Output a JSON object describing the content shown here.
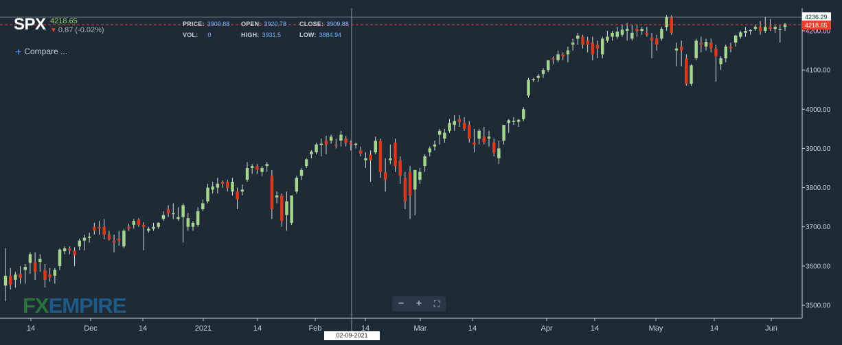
{
  "header": {
    "symbol": "SPX",
    "last_price": "4218.65",
    "change": "0.87 (-0.02%)",
    "price_label": "PRICE:",
    "price_value": "3909.88",
    "open_label": "OPEN:",
    "open_value": "3920.78",
    "close_label": "CLOSE:",
    "close_value": "3909.88",
    "vol_label": "VOL:",
    "vol_value": "0",
    "high_label": "HIGH:",
    "high_value": "3931.5",
    "low_label": "LOW:",
    "low_value": "3884.94"
  },
  "compare": {
    "label": "Compare ..."
  },
  "zoom": {
    "minus": "−",
    "plus": "+",
    "fullscreen": "⛶"
  },
  "logo": {
    "fx": "FX",
    "empire": "EMPIRE"
  },
  "crosshair": {
    "date": "02-09-2021"
  },
  "colors": {
    "up": "#a6d68e",
    "down": "#d63a1f",
    "wick": "#d7dde3",
    "background": "#1e2a35",
    "crosshair": "#8a96a3",
    "price_line": "#e4402c"
  },
  "chart_data": {
    "type": "candlestick",
    "ylim": [
      3475,
      4250
    ],
    "yticks": [
      "3500.00",
      "3600.00",
      "3700.00",
      "3800.00",
      "3900.00",
      "4000.00",
      "4100.00",
      "4200.00"
    ],
    "ytick_values": [
      3500,
      3600,
      3700,
      3800,
      3900,
      4000,
      4100,
      4200
    ],
    "xtick_labels": [
      "14",
      "Dec",
      "14",
      "2021",
      "14",
      "Feb",
      "14",
      "Mar",
      "14",
      "Apr",
      "14",
      "May",
      "14",
      "Jun"
    ],
    "price_flags": {
      "high": "4236.29",
      "last": "4218.65"
    },
    "candles": [
      [
        3550,
        3645,
        3510,
        3575
      ],
      [
        3575,
        3595,
        3540,
        3552
      ],
      [
        3565,
        3585,
        3545,
        3578
      ],
      [
        3580,
        3600,
        3555,
        3570
      ],
      [
        3590,
        3605,
        3555,
        3598
      ],
      [
        3608,
        3635,
        3580,
        3630
      ],
      [
        3610,
        3635,
        3565,
        3585
      ],
      [
        3610,
        3630,
        3585,
        3618
      ],
      [
        3590,
        3605,
        3545,
        3565
      ],
      [
        3578,
        3595,
        3560,
        3572
      ],
      [
        3575,
        3595,
        3555,
        3590
      ],
      [
        3600,
        3645,
        3590,
        3642
      ],
      [
        3638,
        3650,
        3630,
        3645
      ],
      [
        3645,
        3650,
        3630,
        3640
      ],
      [
        3640,
        3648,
        3600,
        3628
      ],
      [
        3650,
        3670,
        3640,
        3665
      ],
      [
        3665,
        3680,
        3640,
        3672
      ],
      [
        3672,
        3685,
        3660,
        3675
      ],
      [
        3700,
        3710,
        3680,
        3690
      ],
      [
        3700,
        3715,
        3680,
        3695
      ],
      [
        3700,
        3720,
        3668,
        3680
      ],
      [
        3680,
        3690,
        3665,
        3668
      ],
      [
        3665,
        3680,
        3635,
        3660
      ],
      [
        3670,
        3690,
        3652,
        3665
      ],
      [
        3650,
        3695,
        3645,
        3690
      ],
      [
        3700,
        3708,
        3690,
        3695
      ],
      [
        3705,
        3720,
        3695,
        3715
      ],
      [
        3718,
        3722,
        3700,
        3705
      ],
      [
        3705,
        3712,
        3640,
        3700
      ],
      [
        3690,
        3700,
        3685,
        3695
      ],
      [
        3695,
        3710,
        3690,
        3700
      ],
      [
        3700,
        3712,
        3695,
        3710
      ],
      [
        3720,
        3740,
        3715,
        3730
      ],
      [
        3745,
        3755,
        3725,
        3735
      ],
      [
        3735,
        3760,
        3720,
        3735
      ],
      [
        3720,
        3750,
        3715,
        3725
      ],
      [
        3725,
        3760,
        3660,
        3755
      ],
      [
        3700,
        3735,
        3690,
        3722
      ],
      [
        3700,
        3715,
        3690,
        3710
      ],
      [
        3705,
        3750,
        3700,
        3740
      ],
      [
        3745,
        3770,
        3740,
        3760
      ],
      [
        3765,
        3810,
        3760,
        3800
      ],
      [
        3795,
        3815,
        3785,
        3803
      ],
      [
        3800,
        3825,
        3785,
        3810
      ],
      [
        3815,
        3818,
        3800,
        3810
      ],
      [
        3815,
        3820,
        3790,
        3800
      ],
      [
        3790,
        3825,
        3780,
        3815
      ],
      [
        3790,
        3800,
        3745,
        3770
      ],
      [
        3790,
        3808,
        3780,
        3795
      ],
      [
        3820,
        3865,
        3815,
        3850
      ],
      [
        3850,
        3860,
        3835,
        3855
      ],
      [
        3855,
        3860,
        3835,
        3845
      ],
      [
        3840,
        3855,
        3830,
        3850
      ],
      [
        3855,
        3865,
        3840,
        3860
      ],
      [
        3830,
        3845,
        3720,
        3745
      ],
      [
        3775,
        3790,
        3760,
        3780
      ],
      [
        3780,
        3785,
        3700,
        3715
      ],
      [
        3730,
        3790,
        3690,
        3765
      ],
      [
        3710,
        3775,
        3705,
        3780
      ],
      [
        3790,
        3830,
        3785,
        3825
      ],
      [
        3830,
        3850,
        3820,
        3845
      ],
      [
        3855,
        3875,
        3850,
        3872
      ],
      [
        3885,
        3895,
        3875,
        3892
      ],
      [
        3890,
        3915,
        3885,
        3910
      ],
      [
        3910,
        3925,
        3880,
        3912
      ],
      [
        3920,
        3932,
        3885,
        3910
      ],
      [
        3920,
        3935,
        3912,
        3930
      ],
      [
        3910,
        3925,
        3900,
        3908
      ],
      [
        3920,
        3945,
        3905,
        3935
      ],
      [
        3925,
        3932,
        3905,
        3915
      ],
      [
        3915,
        3920,
        3895,
        3910
      ],
      [
        3910,
        3915,
        3900,
        3912
      ],
      [
        3895,
        3905,
        3880,
        3887
      ],
      [
        3870,
        3890,
        3850,
        3875
      ],
      [
        3885,
        3895,
        3815,
        3870
      ],
      [
        3890,
        3930,
        3885,
        3920
      ],
      [
        3920,
        3925,
        3825,
        3840
      ],
      [
        3840,
        3875,
        3790,
        3820
      ],
      [
        3870,
        3910,
        3860,
        3875
      ],
      [
        3915,
        3925,
        3840,
        3855
      ],
      [
        3870,
        3880,
        3810,
        3830
      ],
      [
        3825,
        3840,
        3745,
        3765
      ],
      [
        3840,
        3855,
        3720,
        3780
      ],
      [
        3795,
        3845,
        3730,
        3845
      ],
      [
        3820,
        3850,
        3810,
        3840
      ],
      [
        3855,
        3885,
        3840,
        3880
      ],
      [
        3890,
        3905,
        3880,
        3900
      ],
      [
        3905,
        3920,
        3895,
        3910
      ],
      [
        3935,
        3950,
        3910,
        3945
      ],
      [
        3925,
        3950,
        3915,
        3940
      ],
      [
        3945,
        3975,
        3940,
        3965
      ],
      [
        3960,
        3985,
        3945,
        3970
      ],
      [
        3975,
        3985,
        3955,
        3968
      ],
      [
        3965,
        3980,
        3945,
        3950
      ],
      [
        3960,
        3970,
        3915,
        3925
      ],
      [
        3915,
        3950,
        3890,
        3910
      ],
      [
        3925,
        3950,
        3910,
        3945
      ],
      [
        3930,
        3955,
        3910,
        3915
      ],
      [
        3925,
        3945,
        3905,
        3930
      ],
      [
        3915,
        3925,
        3880,
        3890
      ],
      [
        3875,
        3920,
        3860,
        3900
      ],
      [
        3920,
        3960,
        3910,
        3960
      ],
      [
        3965,
        3975,
        3940,
        3972
      ],
      [
        3970,
        3980,
        3960,
        3970
      ],
      [
        3968,
        3975,
        3955,
        3973
      ],
      [
        3975,
        4005,
        3970,
        4000
      ],
      [
        4035,
        4080,
        4030,
        4075
      ],
      [
        4075,
        4080,
        4070,
        4077
      ],
      [
        4080,
        4090,
        4070,
        4085
      ],
      [
        4090,
        4105,
        4080,
        4100
      ],
      [
        4100,
        4125,
        4095,
        4125
      ],
      [
        4130,
        4135,
        4115,
        4128
      ],
      [
        4125,
        4150,
        4120,
        4140
      ],
      [
        4140,
        4145,
        4125,
        4135
      ],
      [
        4140,
        4160,
        4120,
        4150
      ],
      [
        4165,
        4180,
        4150,
        4170
      ],
      [
        4180,
        4195,
        4165,
        4188
      ],
      [
        4185,
        4190,
        4155,
        4165
      ],
      [
        4175,
        4185,
        4145,
        4165
      ],
      [
        4170,
        4185,
        4125,
        4140
      ],
      [
        4165,
        4175,
        4130,
        4155
      ],
      [
        4140,
        4185,
        4130,
        4180
      ],
      [
        4175,
        4200,
        4170,
        4185
      ],
      [
        4185,
        4200,
        4175,
        4195
      ],
      [
        4185,
        4210,
        4180,
        4198
      ],
      [
        4190,
        4215,
        4185,
        4203
      ],
      [
        4200,
        4220,
        4175,
        4205
      ],
      [
        4180,
        4215,
        4175,
        4195
      ],
      [
        4205,
        4215,
        4185,
        4200
      ],
      [
        4200,
        4210,
        4190,
        4205
      ],
      [
        4195,
        4210,
        4185,
        4190
      ],
      [
        4182,
        4195,
        4130,
        4175
      ],
      [
        4180,
        4190,
        4150,
        4165
      ],
      [
        4180,
        4210,
        4175,
        4205
      ],
      [
        4210,
        4240,
        4200,
        4235
      ],
      [
        4235,
        4240,
        4190,
        4195
      ],
      [
        4150,
        4170,
        4110,
        4155
      ],
      [
        4160,
        4175,
        4110,
        4150
      ],
      [
        4130,
        4140,
        4060,
        4065
      ],
      [
        4065,
        4115,
        4060,
        4112
      ],
      [
        4130,
        4180,
        4125,
        4175
      ],
      [
        4170,
        4185,
        4145,
        4165
      ],
      [
        4160,
        4180,
        4150,
        4172
      ],
      [
        4170,
        4180,
        4145,
        4155
      ],
      [
        4155,
        4165,
        4070,
        4135
      ],
      [
        4115,
        4135,
        4100,
        4130
      ],
      [
        4130,
        4165,
        4120,
        4160
      ],
      [
        4160,
        4170,
        4145,
        4155
      ],
      [
        4170,
        4190,
        4160,
        4188
      ],
      [
        4185,
        4200,
        4180,
        4196
      ],
      [
        4195,
        4210,
        4185,
        4200
      ],
      [
        4200,
        4205,
        4190,
        4202
      ],
      [
        4205,
        4215,
        4200,
        4210
      ],
      [
        4210,
        4225,
        4190,
        4200
      ],
      [
        4200,
        4235,
        4195,
        4210
      ],
      [
        4210,
        4230,
        4200,
        4205
      ],
      [
        4205,
        4215,
        4195,
        4210
      ],
      [
        4205,
        4215,
        4170,
        4205
      ],
      [
        4210,
        4220,
        4200,
        4218
      ]
    ]
  }
}
